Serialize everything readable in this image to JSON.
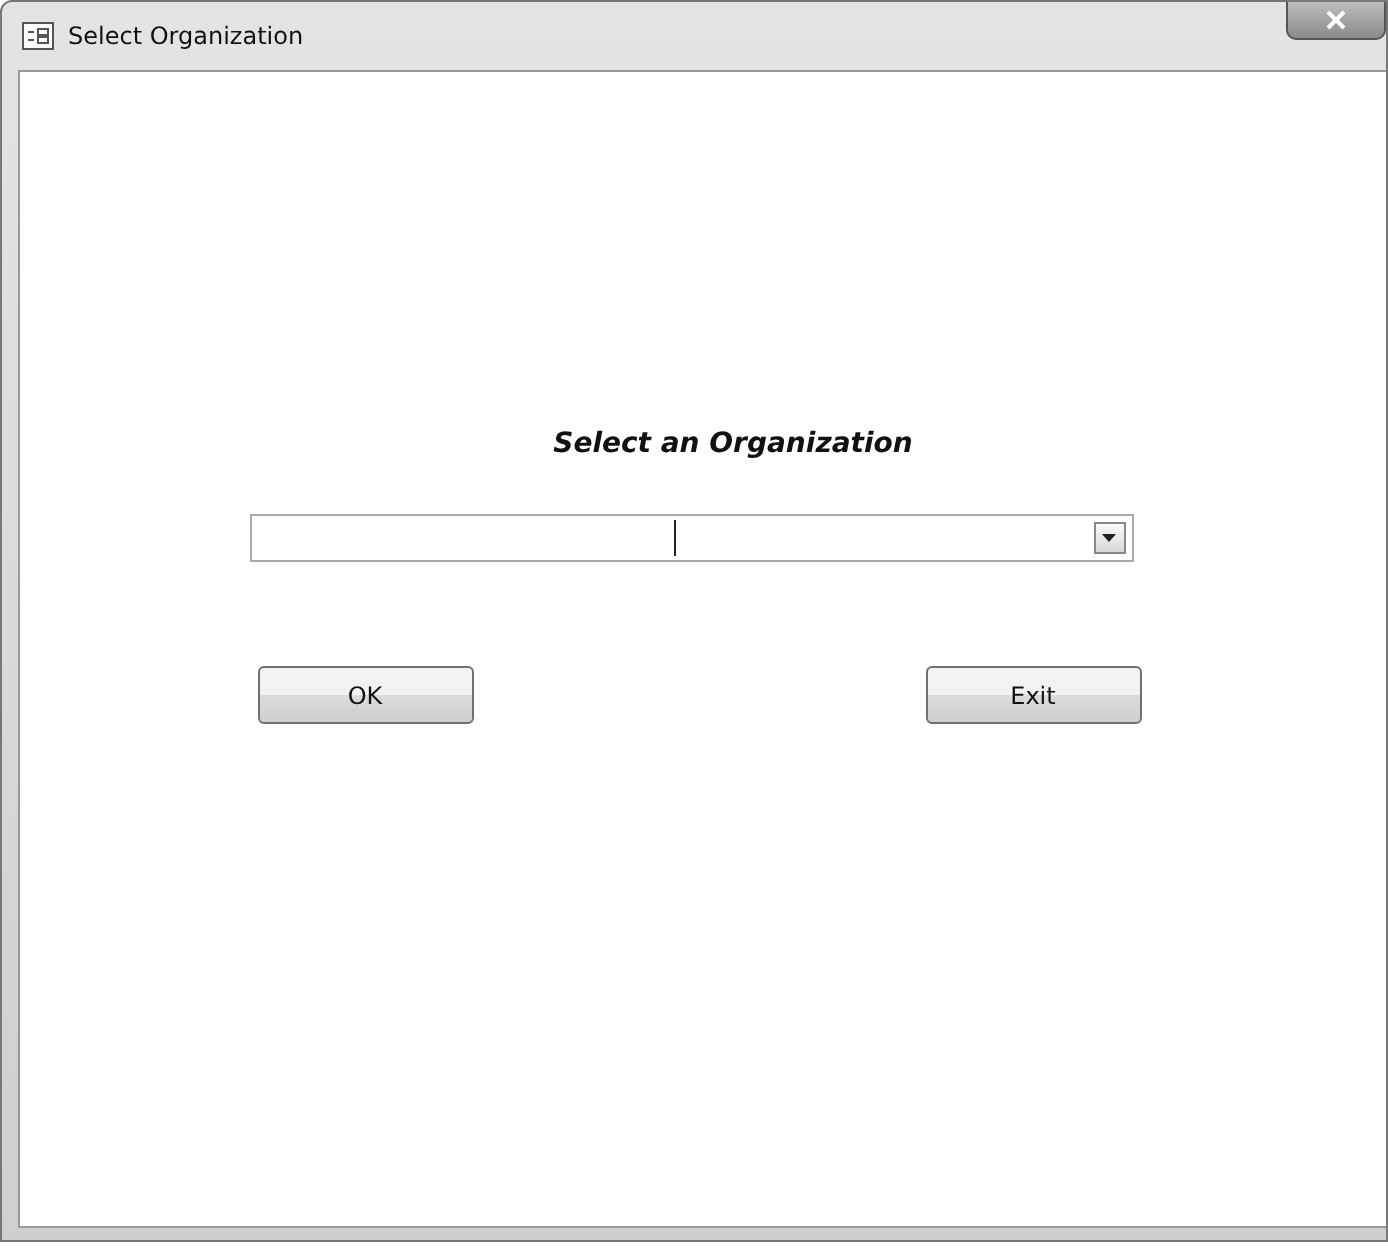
{
  "window": {
    "title": "Select Organization"
  },
  "form": {
    "heading": "Select an Organization"
  },
  "buttons": [
    {
      "label": "OK"
    },
    {
      "label": "Exit"
    }
  ]
}
